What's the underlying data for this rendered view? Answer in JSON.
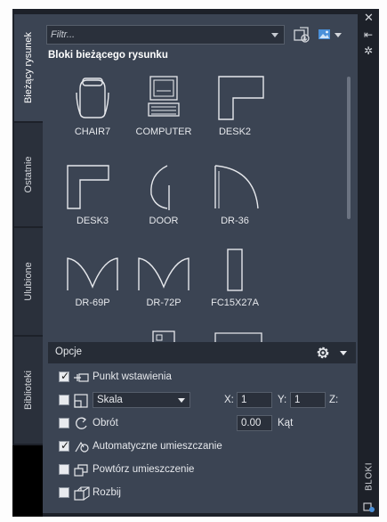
{
  "tabs": [
    {
      "label": "Bieżący rysunek"
    },
    {
      "label": "Ostatnie"
    },
    {
      "label": "Ulubione"
    },
    {
      "label": "Biblioteki"
    }
  ],
  "toolbar": {
    "filter_placeholder": "Filtr...",
    "insert_icon": "import-block-icon",
    "view_icon": "thumbnail-view-icon"
  },
  "section_title": "Bloki bieżącego rysunku",
  "blocks": [
    {
      "name": "CHAIR7",
      "icon": "chair-icon"
    },
    {
      "name": "COMPUTER",
      "icon": "computer-icon"
    },
    {
      "name": "DESK2",
      "icon": "desk-l-icon"
    },
    {
      "name": "DESK3",
      "icon": "desk-l-icon"
    },
    {
      "name": "DOOR",
      "icon": "door-icon"
    },
    {
      "name": "DR-36",
      "icon": "door-swing-icon"
    },
    {
      "name": "DR-69P",
      "icon": "double-door-icon"
    },
    {
      "name": "DR-72P",
      "icon": "double-door-icon"
    },
    {
      "name": "FC15X27A",
      "icon": "cabinet-icon"
    }
  ],
  "options": {
    "header": "Opcje",
    "insertion_point": {
      "label": "Punkt wstawienia",
      "checked": true
    },
    "scale": {
      "label": "Skala",
      "checked": false,
      "x_label": "X:",
      "x": "1",
      "y_label": "Y:",
      "y": "1",
      "z_label": "Z:"
    },
    "rotation": {
      "label": "Obrót",
      "checked": false,
      "value": "0.00",
      "unit": "Kąt"
    },
    "auto_place": {
      "label": "Automatyczne umieszczanie",
      "checked": true
    },
    "repeat_place": {
      "label": "Powtórz umieszczenie",
      "checked": false
    },
    "explode": {
      "label": "Rozbij",
      "checked": false
    }
  },
  "palette": {
    "title": "BLOKI"
  },
  "colors": {
    "panel": "#3b4453",
    "frame": "#1d2129",
    "accent": "#4a90d9"
  }
}
